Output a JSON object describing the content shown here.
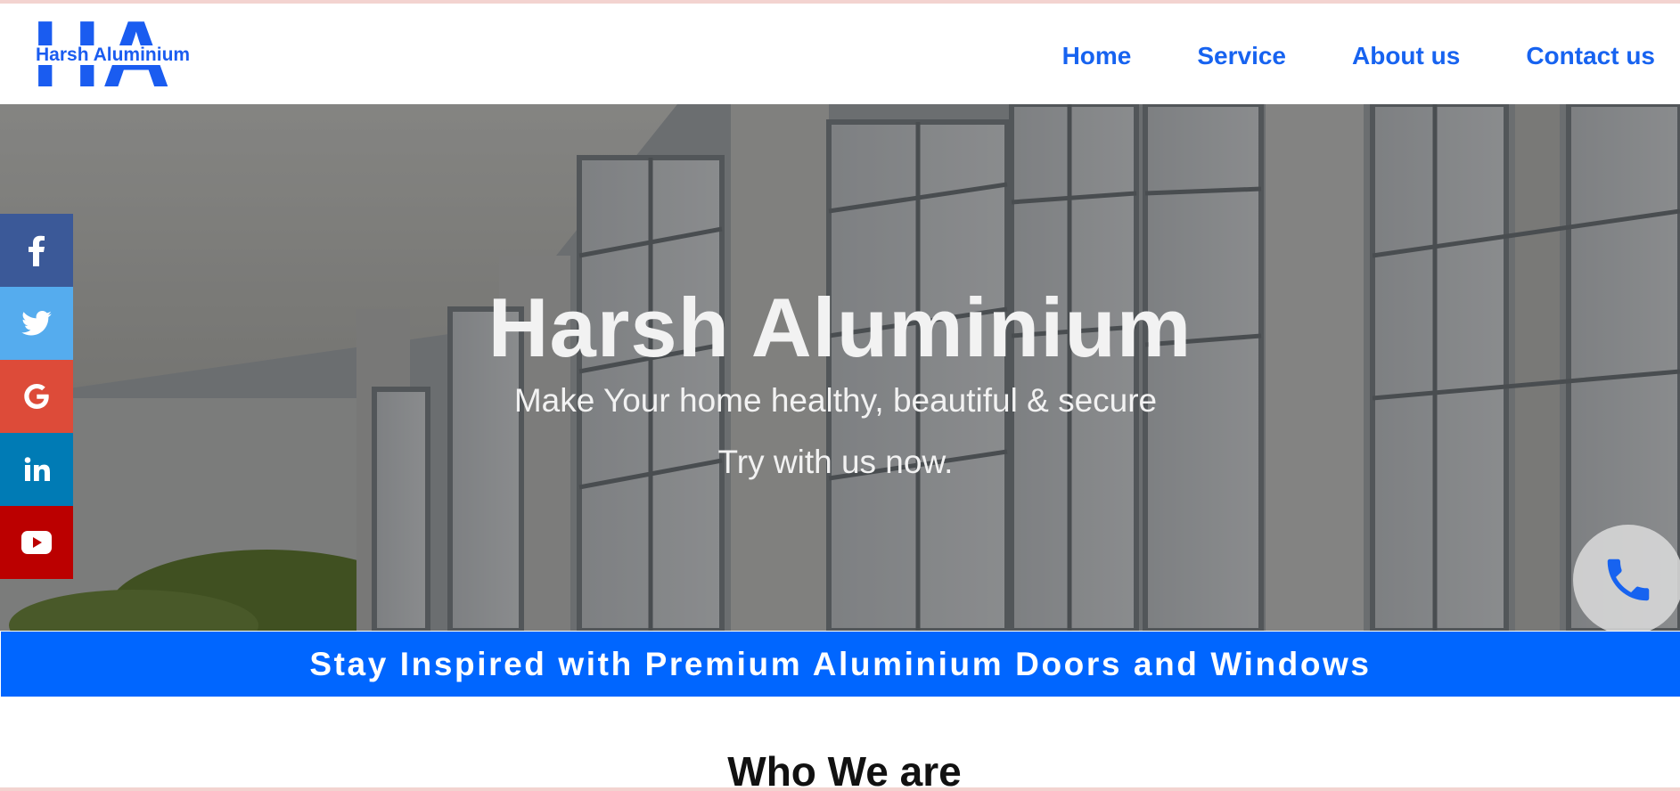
{
  "logo": {
    "monogram": "HA",
    "name": "Harsh Aluminium"
  },
  "nav": {
    "items": [
      "Home",
      "Service",
      "About us",
      "Contact us"
    ]
  },
  "hero": {
    "title": "Harsh Aluminium",
    "subtitle": "Make Your home healthy, beautiful & secure",
    "cta": "Try with us now."
  },
  "social": {
    "items": [
      "facebook-icon",
      "twitter-icon",
      "google-icon",
      "linkedin-icon",
      "youtube-icon"
    ],
    "colors": [
      "#3b5998",
      "#55acee",
      "#dd4b39",
      "#007bb5",
      "#bb0000"
    ]
  },
  "banner": {
    "text": "Stay Inspired with Premium Aluminium Doors and Windows",
    "color": "#0066ff"
  },
  "section": {
    "title": "Who We are"
  },
  "colors": {
    "brand": "#1a5cf0",
    "nav_link": "#1763f0"
  }
}
